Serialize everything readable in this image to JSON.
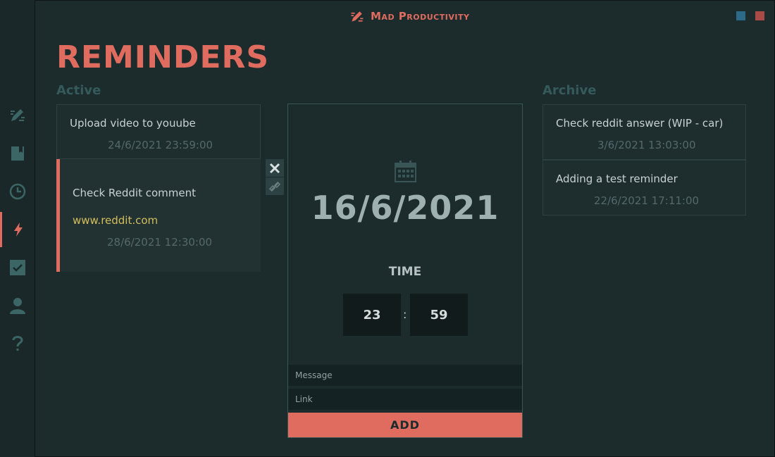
{
  "app": {
    "title": "Mad Productivity"
  },
  "colors": {
    "accent": "#e06b5f",
    "background": "#1c2b2c",
    "minimize": "#2d6a87",
    "close": "#a84a46",
    "link": "#d4be5b"
  },
  "sidebar": {
    "items": [
      {
        "icon": "logo-pencil-icon",
        "active": false
      },
      {
        "icon": "notebook-icon",
        "active": false
      },
      {
        "icon": "clock-icon",
        "active": false
      },
      {
        "icon": "lightning-icon",
        "active": true
      },
      {
        "icon": "checkbox-icon",
        "active": false
      },
      {
        "icon": "user-icon",
        "active": false
      },
      {
        "icon": "help-icon",
        "active": false
      }
    ]
  },
  "page": {
    "title": "REMINDERS"
  },
  "active": {
    "label": "Active",
    "reminders": [
      {
        "message": "Upload video to youube",
        "date": "24/6/2021 23:59:00"
      },
      {
        "message": "Check Reddit comment",
        "link": "www.reddit.com",
        "date": "28/6/2021 12:30:00"
      }
    ]
  },
  "archive": {
    "label": "Archive",
    "reminders": [
      {
        "message": "Check reddit answer (WIP - car)",
        "date": "3/6/2021 13:03:00"
      },
      {
        "message": "Adding a test reminder",
        "date": "22/6/2021 17:11:00"
      }
    ]
  },
  "form": {
    "date": "16/6/2021",
    "time_label": "TIME",
    "hour": "23",
    "minute": "59",
    "separator": ":",
    "message_placeholder": "Message",
    "link_placeholder": "Link",
    "add_label": "ADD"
  }
}
